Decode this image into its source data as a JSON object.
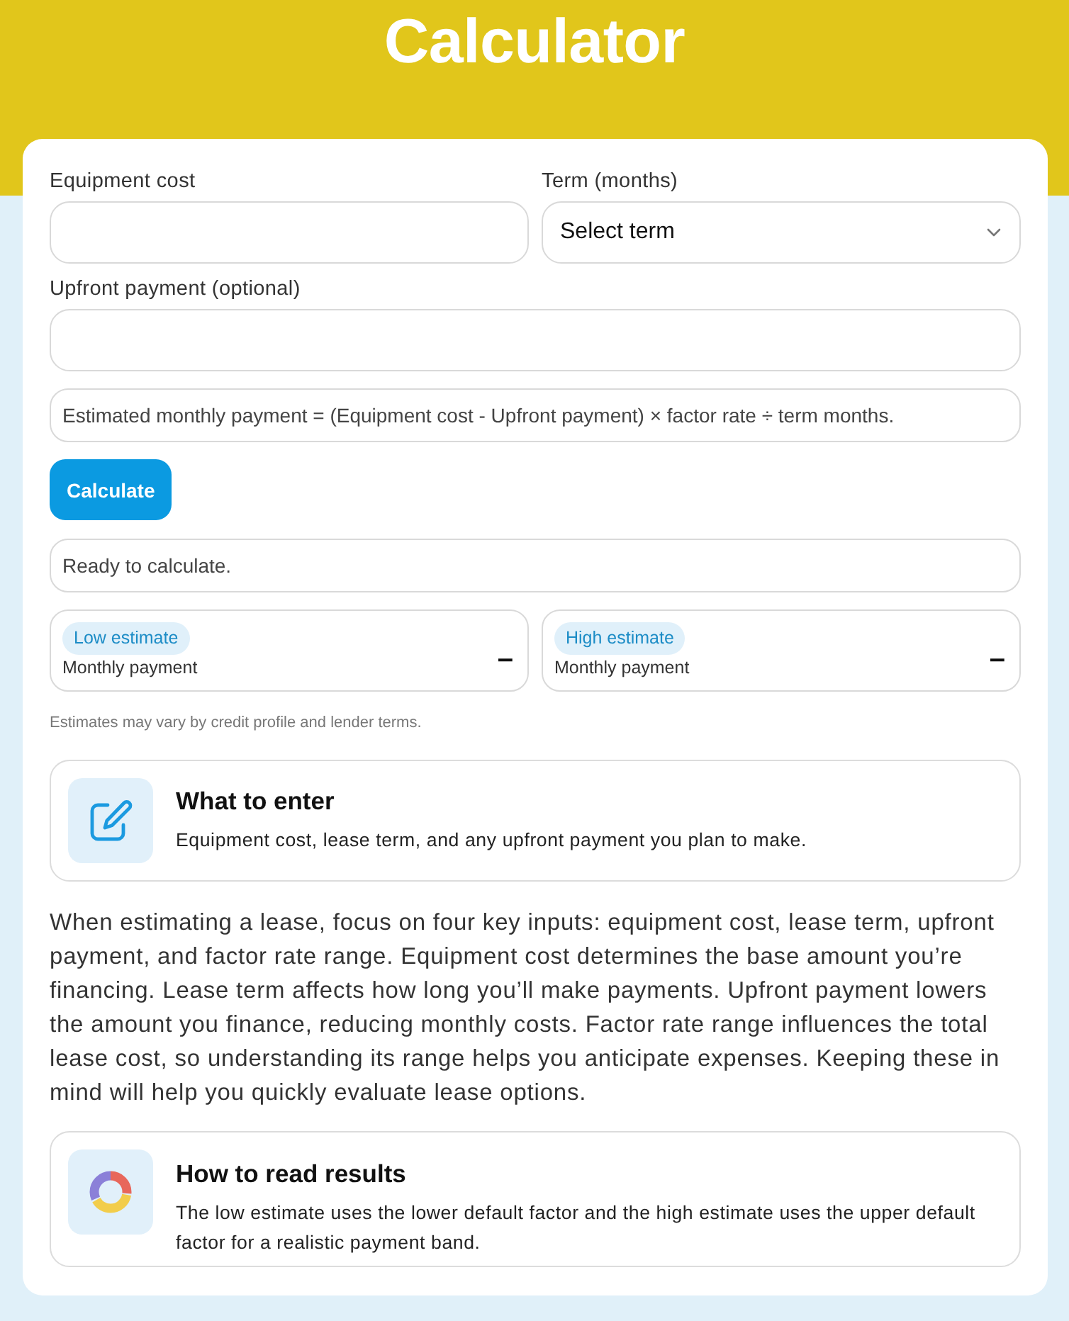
{
  "header": {
    "title": "Calculator"
  },
  "form": {
    "field_rows": [
      [
        {
          "kind": "input",
          "label": "Equipment cost"
        },
        {
          "kind": "select",
          "label": "Term (months)",
          "value": "Select term"
        }
      ],
      [
        {
          "kind": "input",
          "label": "Upfront payment (optional)"
        }
      ]
    ],
    "formula": "Estimated monthly payment = (Equipment cost - Upfront payment) × factor rate ÷ term months.",
    "button": "Calculate",
    "status": "Ready to calculate.",
    "estimates": [
      {
        "badge": "Low estimate",
        "caption": "Monthly payment",
        "value": "–"
      },
      {
        "badge": "High estimate",
        "caption": "Monthly payment",
        "value": "–"
      }
    ],
    "disclaimer": "Estimates may vary by credit profile and lender terms."
  },
  "what_to_enter": {
    "title": "What to enter",
    "text": "Equipment cost, lease term, and any upfront payment you plan to make."
  },
  "paragraph": "When estimating a lease, focus on four key inputs: equipment cost, lease term, upfront payment, and factor rate range. Equipment cost determines the base amount you’re financing. Lease term affects how long you’ll make payments. Upfront payment lowers the amount you finance, reducing monthly costs. Factor rate range influences the total lease cost, so understanding its range helps you anticipate expenses. Keeping these in mind will help you quickly evaluate lease options.",
  "how_to_read": {
    "title": "How to read results",
    "text": "The low estimate uses the lower default factor and the high estimate uses the upper default factor for a realistic payment band."
  }
}
